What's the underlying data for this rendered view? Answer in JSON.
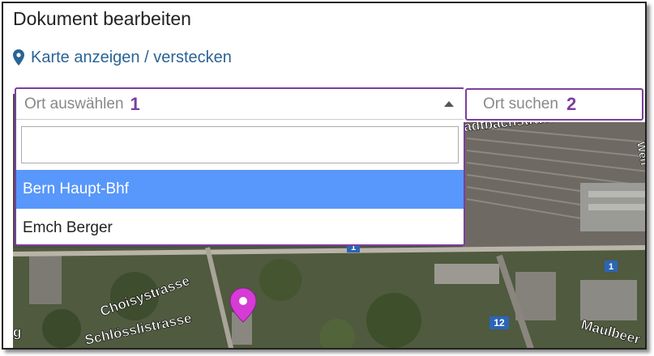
{
  "header": {
    "title": "Dokument bearbeiten"
  },
  "map_toggle": {
    "label": "Karte anzeigen / verstecken",
    "icon": "map-marker-icon"
  },
  "place_select": {
    "placeholder": "Ort auswählen",
    "badge": "1",
    "search_value": "",
    "options": [
      {
        "label": "Bern Haupt-Bhf",
        "highlighted": true
      },
      {
        "label": "Emch Berger",
        "highlighted": false
      }
    ]
  },
  "place_search": {
    "placeholder": "Ort suchen",
    "badge": "2"
  },
  "map": {
    "street_labels": [
      "Stadtbachstrasse",
      "Choisystrasse",
      "Schlösslistrasse",
      "Maulbeer",
      "Weh"
    ],
    "route_badges": [
      "1",
      "12",
      "1"
    ],
    "marker_icon": "map-pin-icon",
    "marker_color": "#d63bd6"
  },
  "colors": {
    "accent": "#7b3f9e",
    "link": "#2a6496",
    "highlight": "#5897fb"
  }
}
